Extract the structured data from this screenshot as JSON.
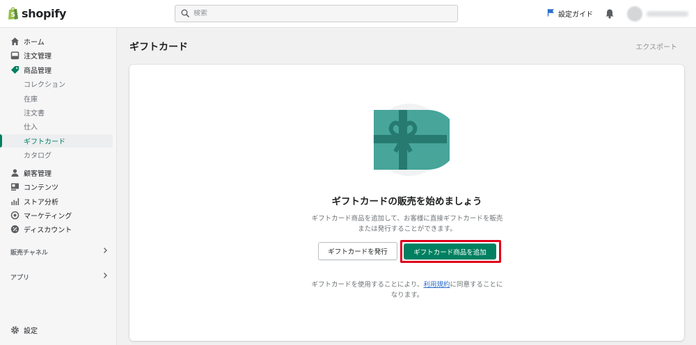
{
  "header": {
    "logo_text": "shopify",
    "search_placeholder": "検索",
    "setup_guide": "設定ガイド"
  },
  "sidebar": {
    "items": [
      {
        "label": "ホーム",
        "icon": "home-icon"
      },
      {
        "label": "注文管理",
        "icon": "inbox-icon"
      },
      {
        "label": "商品管理",
        "icon": "tag-icon"
      },
      {
        "label": "コレクション"
      },
      {
        "label": "在庫"
      },
      {
        "label": "注文書"
      },
      {
        "label": "仕入"
      },
      {
        "label": "ギフトカード"
      },
      {
        "label": "カタログ"
      },
      {
        "label": "顧客管理",
        "icon": "person-icon"
      },
      {
        "label": "コンテンツ",
        "icon": "content-icon"
      },
      {
        "label": "ストア分析",
        "icon": "analytics-icon"
      },
      {
        "label": "マーケティング",
        "icon": "target-icon"
      },
      {
        "label": "ディスカウント",
        "icon": "discount-icon"
      }
    ],
    "sales_channels": "販売チャネル",
    "apps": "アプリ",
    "settings": "設定"
  },
  "main": {
    "title": "ギフトカード",
    "export": "エクスポート",
    "empty_title": "ギフトカードの販売を始めましょう",
    "empty_desc": "ギフトカード商品を追加して、お客様に直接ギフトカードを販売または発行することができます。",
    "issue_button": "ギフトカードを発行",
    "add_button": "ギフトカード商品を追加",
    "note_before": "ギフトカードを使用することにより、",
    "note_link": "利用規約",
    "note_after": "に同意することになります。"
  },
  "colors": {
    "accent": "#008060",
    "highlight_border": "#e0001b",
    "illustration": "#47a59a"
  }
}
